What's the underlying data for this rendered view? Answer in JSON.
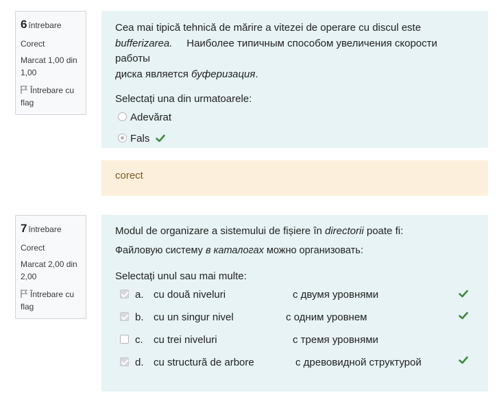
{
  "q6": {
    "number": "6",
    "word": "întrebare",
    "state": "Corect",
    "mark": "Marcat 1,00 din 1,00",
    "flag": "Întrebare cu flag",
    "text_ro_1": "Cea mai tipică tehnică de mărire a vitezei de operare cu discul este",
    "text_ro_2": "bufferizarea.",
    "text_ru_1": "Наиболее типичным способом увеличения скорости работы",
    "text_ru_2": "диска является",
    "text_ru_3": "буферизация",
    "text_ru_4": ".",
    "prompt": "Selectați una din urmatoarele:",
    "answers": [
      {
        "label": "Adevărat",
        "checked": false,
        "correct": false
      },
      {
        "label": "Fals",
        "checked": true,
        "correct": true
      }
    ],
    "feedback": "corect"
  },
  "q7": {
    "number": "7",
    "word": "întrebare",
    "state": "Corect",
    "mark": "Marcat 2,00 din 2,00",
    "flag": "Întrebare cu flag",
    "text_ro_1": "Modul de organizare a sistemului de fișiere în",
    "text_ro_2": "directorii",
    "text_ro_3": "poate fi:",
    "text_ru_1": "Файловую систему",
    "text_ru_2": "в каталогах",
    "text_ru_3": "можно организовать:",
    "prompt": "Selectați unul sau mai multe:",
    "answers": [
      {
        "letter": "a.",
        "ro": "cu două niveluri",
        "ru": "с двумя уровнями",
        "checked": true,
        "correct": true
      },
      {
        "letter": "b.",
        "ro": "cu un singur nivel",
        "ru": "с одним уровнем",
        "checked": true,
        "correct": true
      },
      {
        "letter": "c.",
        "ro": "cu trei niveluri",
        "ru": "с тремя уровнями",
        "checked": false,
        "correct": false
      },
      {
        "letter": "d.",
        "ro": "cu structură de arbore",
        "ru": "с древовидной структурой",
        "checked": true,
        "correct": true
      }
    ]
  }
}
